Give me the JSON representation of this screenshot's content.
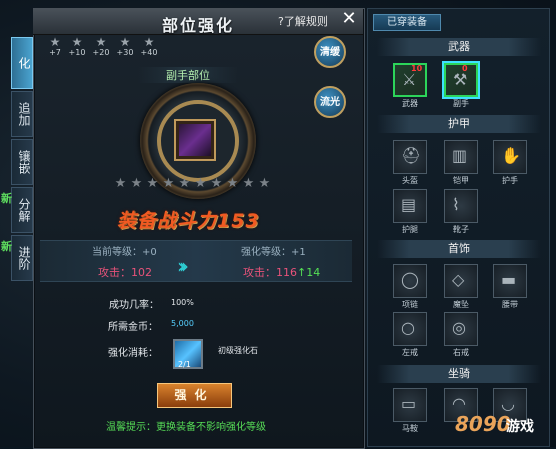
{
  "window": {
    "title": "部位强化",
    "help": "?了解规则",
    "close": "✕"
  },
  "tabs": [
    {
      "label": "化",
      "active": true,
      "new": false
    },
    {
      "label": "追加",
      "active": false,
      "new": false
    },
    {
      "label": "镶嵌",
      "active": false,
      "new": false
    },
    {
      "label": "分解",
      "active": false,
      "new": true
    },
    {
      "label": "进阶",
      "active": false,
      "new": true
    }
  ],
  "new_tag": "新",
  "star_strip": [
    "+7",
    "+10",
    "+20",
    "+30",
    "+40"
  ],
  "side_buttons": {
    "clear": "清缓",
    "flow": "流光"
  },
  "part": {
    "label": "副手部位"
  },
  "grade_stars_total": 10,
  "power": "装备战斗力153",
  "levels": {
    "current": "当前等级：+0",
    "next": "强化等级：+1",
    "atk_label": "攻击：",
    "atk_current": "102",
    "atk_next": "116",
    "atk_gain": "↑14"
  },
  "info": {
    "success_label": "成功几率：",
    "success_val": "100%",
    "gold_label": "所需金币：",
    "gold_val": "5,000",
    "consume_label": "强化消耗：",
    "material_count": "2/1",
    "material_name": "初级强化石"
  },
  "button": {
    "strengthen": "强化"
  },
  "tip": "温馨提示：更换装备不影响强化等级",
  "right": {
    "equipped": "已穿装备",
    "categories": [
      {
        "name": "武器",
        "items": [
          {
            "label": "武器",
            "filled": true,
            "selected": false,
            "badge": "10"
          },
          {
            "label": "副手",
            "filled": true,
            "selected": true,
            "badge": "0"
          }
        ]
      },
      {
        "name": "护甲",
        "items": [
          {
            "label": "头盔",
            "filled": false,
            "selected": false,
            "badge": ""
          },
          {
            "label": "铠甲",
            "filled": false,
            "selected": false,
            "badge": ""
          },
          {
            "label": "护手",
            "filled": false,
            "selected": false,
            "badge": ""
          },
          {
            "label": "护腿",
            "filled": false,
            "selected": false,
            "badge": ""
          },
          {
            "label": "靴子",
            "filled": false,
            "selected": false,
            "badge": ""
          }
        ]
      },
      {
        "name": "首饰",
        "items": [
          {
            "label": "项链",
            "filled": false,
            "selected": false,
            "badge": ""
          },
          {
            "label": "魔坠",
            "filled": false,
            "selected": false,
            "badge": ""
          },
          {
            "label": "腰带",
            "filled": false,
            "selected": false,
            "badge": ""
          },
          {
            "label": "左戒",
            "filled": false,
            "selected": false,
            "badge": ""
          },
          {
            "label": "右戒",
            "filled": false,
            "selected": false,
            "badge": ""
          }
        ]
      },
      {
        "name": "坐骑",
        "items": [
          {
            "label": "马鞍",
            "filled": false,
            "selected": false,
            "badge": ""
          },
          {
            "label": "",
            "filled": false,
            "selected": false,
            "badge": ""
          },
          {
            "label": "",
            "filled": false,
            "selected": false,
            "badge": ""
          }
        ]
      }
    ]
  },
  "watermark": {
    "brand": "8090",
    "suffix": "游戏"
  }
}
